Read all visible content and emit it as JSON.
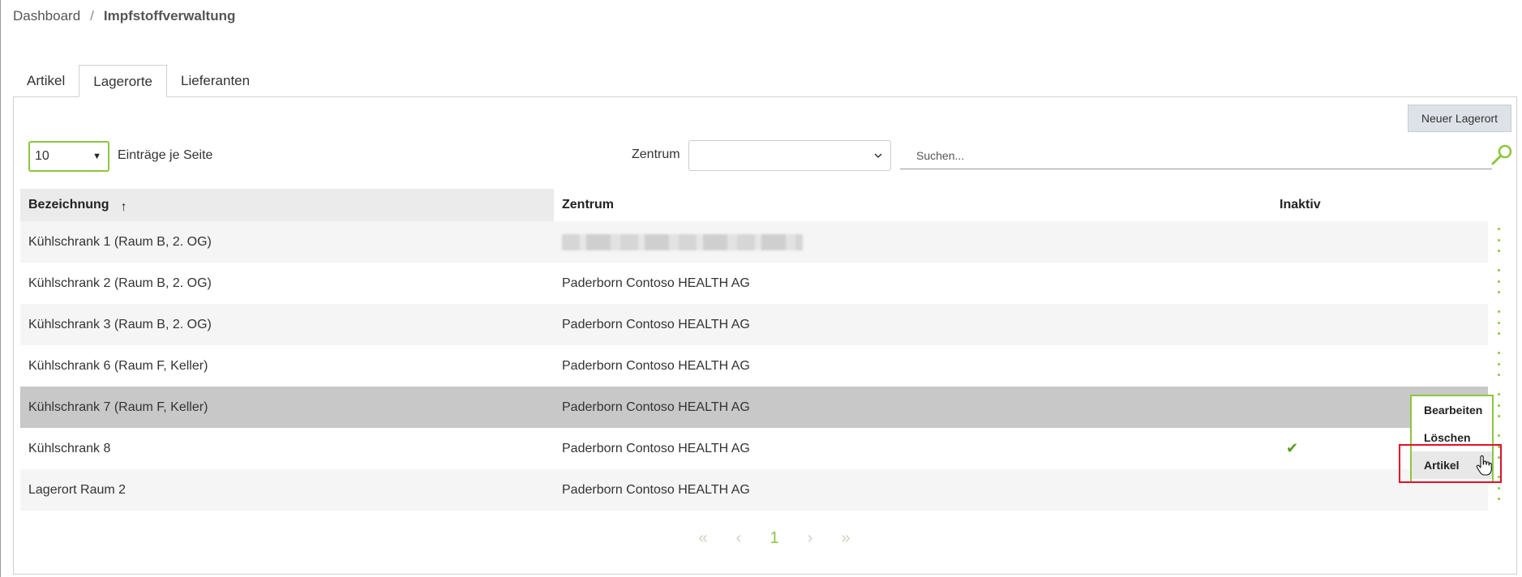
{
  "breadcrumb": {
    "root": "Dashboard",
    "separator": "/",
    "current": "Impfstoffverwaltung"
  },
  "tabs": [
    {
      "label": "Artikel"
    },
    {
      "label": "Lagerorte"
    },
    {
      "label": "Lieferanten"
    }
  ],
  "active_tab": "Lagerorte",
  "toolbar": {
    "new_button": "Neuer Lagerort",
    "page_size_value": "10",
    "page_size_label": "Einträge je Seite",
    "zentrum_label": "Zentrum",
    "zentrum_value": "",
    "search_placeholder": "Suchen..."
  },
  "table": {
    "headers": {
      "bezeichnung": "Bezeichnung",
      "sort_indicator": "↑",
      "zentrum": "Zentrum",
      "inaktiv": "Inaktiv"
    },
    "rows": [
      {
        "bezeichnung": "Kühlschrank 1 (Raum B, 2. OG)",
        "zentrum": "",
        "zentrum_blurred": true,
        "inaktiv": ""
      },
      {
        "bezeichnung": "Kühlschrank 2 (Raum B, 2. OG)",
        "zentrum": "Paderborn Contoso HEALTH AG",
        "inaktiv": ""
      },
      {
        "bezeichnung": "Kühlschrank 3 (Raum B, 2. OG)",
        "zentrum": "Paderborn Contoso HEALTH AG",
        "inaktiv": ""
      },
      {
        "bezeichnung": "Kühlschrank 6 (Raum F, Keller)",
        "zentrum": "Paderborn Contoso HEALTH AG",
        "inaktiv": ""
      },
      {
        "bezeichnung": "Kühlschrank 7 (Raum F, Keller)",
        "zentrum": "Paderborn Contoso HEALTH AG",
        "inaktiv": "",
        "selected": true
      },
      {
        "bezeichnung": "Kühlschrank 8",
        "zentrum": "Paderborn Contoso HEALTH AG",
        "inaktiv": "✔"
      },
      {
        "bezeichnung": "Lagerort Raum 2",
        "zentrum": "Paderborn Contoso HEALTH AG",
        "inaktiv": ""
      }
    ]
  },
  "context_menu": {
    "items": [
      "Bearbeiten",
      "Löschen",
      "Artikel"
    ],
    "hovered": "Artikel"
  },
  "pagination": {
    "first": "«",
    "prev": "‹",
    "current": "1",
    "next": "›",
    "last": "»"
  },
  "colors": {
    "accent": "#8dc63f",
    "highlight": "#e0102a",
    "selected_row": "#c8c8c8",
    "check": "#5a9e1f"
  }
}
